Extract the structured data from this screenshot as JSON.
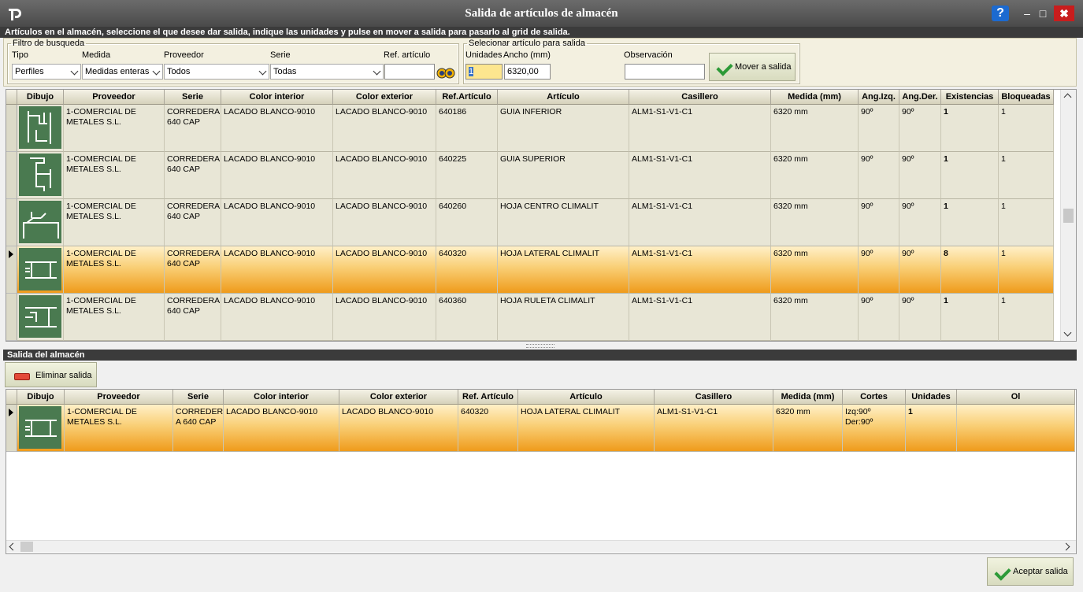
{
  "window": {
    "title": "Salida de artículos de almacén",
    "help": "?",
    "minimize": "–",
    "maximize": "□",
    "close": "✖"
  },
  "instructions": "Artículos en el almacén, seleccione el que desee dar salida, indique las unidades y pulse en mover a salida para pasarlo al grid de salida.",
  "filter": {
    "legend": "Filtro de busqueda",
    "tipo_label": "Tipo",
    "tipo_value": "Perfiles",
    "medida_label": "Medida",
    "medida_value": "Medidas enteras",
    "proveedor_label": "Proveedor",
    "proveedor_value": "Todos",
    "serie_label": "Serie",
    "serie_value": "Todas",
    "ref_label": "Ref. artículo",
    "ref_value": ""
  },
  "select": {
    "legend": "Selecionar artículo para salida",
    "unidades_label": "Unidades",
    "unidades_value": "1",
    "ancho_label": "Ancho (mm)",
    "ancho_value": "6320,00",
    "observacion_label": "Observación",
    "observacion_value": "",
    "move_button": "Mover a salida"
  },
  "stock_grid": {
    "columns": [
      "Dibujo",
      "Proveedor",
      "Serie",
      "Color interior",
      "Color exterior",
      "Ref.Artículo",
      "Artículo",
      "Casillero",
      "Medida (mm)",
      "Ang.Izq.",
      "Ang.Der.",
      "Existencias",
      "Bloqueadas"
    ],
    "rows": [
      {
        "proveedor": "1-COMERCIAL DE METALES S.L.",
        "serie": "CORREDERA 640 CAP",
        "color_int": "LACADO BLANCO-9010",
        "color_ext": "LACADO BLANCO-9010",
        "ref": "640186",
        "articulo": "GUIA INFERIOR",
        "casillero": "ALM1-S1-V1-C1",
        "medida": "6320 mm",
        "ang_izq": "90º",
        "ang_der": "90º",
        "existencias": "1",
        "bloqueadas": "1"
      },
      {
        "proveedor": "1-COMERCIAL DE METALES S.L.",
        "serie": "CORREDERA 640 CAP",
        "color_int": "LACADO BLANCO-9010",
        "color_ext": "LACADO BLANCO-9010",
        "ref": "640225",
        "articulo": "GUIA SUPERIOR",
        "casillero": "ALM1-S1-V1-C1",
        "medida": "6320 mm",
        "ang_izq": "90º",
        "ang_der": "90º",
        "existencias": "1",
        "bloqueadas": "1"
      },
      {
        "proveedor": "1-COMERCIAL DE METALES S.L.",
        "serie": "CORREDERA 640 CAP",
        "color_int": "LACADO BLANCO-9010",
        "color_ext": "LACADO BLANCO-9010",
        "ref": "640260",
        "articulo": "HOJA CENTRO CLIMALIT",
        "casillero": "ALM1-S1-V1-C1",
        "medida": "6320 mm",
        "ang_izq": "90º",
        "ang_der": "90º",
        "existencias": "1",
        "bloqueadas": "1"
      },
      {
        "proveedor": "1-COMERCIAL DE METALES S.L.",
        "serie": "CORREDERA 640 CAP",
        "color_int": "LACADO BLANCO-9010",
        "color_ext": "LACADO BLANCO-9010",
        "ref": "640320",
        "articulo": "HOJA LATERAL CLIMALIT",
        "casillero": "ALM1-S1-V1-C1",
        "medida": "6320 mm",
        "ang_izq": "90º",
        "ang_der": "90º",
        "existencias": "8",
        "bloqueadas": "1"
      },
      {
        "proveedor": "1-COMERCIAL DE METALES S.L.",
        "serie": "CORREDERA 640 CAP",
        "color_int": "LACADO BLANCO-9010",
        "color_ext": "LACADO BLANCO-9010",
        "ref": "640360",
        "articulo": "HOJA RULETA CLIMALIT",
        "casillero": "ALM1-S1-V1-C1",
        "medida": "6320 mm",
        "ang_izq": "90º",
        "ang_der": "90º",
        "existencias": "1",
        "bloqueadas": "1"
      }
    ]
  },
  "exit_section": {
    "title": "Salida del almacén",
    "remove_button": "Eliminar salida",
    "columns": [
      "Dibujo",
      "Proveedor",
      "Serie",
      "Color interior",
      "Color exterior",
      "Ref. Artículo",
      "Artículo",
      "Casillero",
      "Medida (mm)",
      "Cortes",
      "Unidades",
      "Ol"
    ],
    "rows": [
      {
        "proveedor": "1-COMERCIAL DE METALES S.L.",
        "serie": "CORREDER A 640 CAP",
        "color_int": "LACADO BLANCO-9010",
        "color_ext": "LACADO BLANCO-9010",
        "ref": "640320",
        "articulo": "HOJA LATERAL CLIMALIT",
        "casillero": "ALM1-S1-V1-C1",
        "medida": "6320 mm",
        "cortes_izq": "Izq:90º",
        "cortes_der": "Der:90º",
        "unidades": "1"
      }
    ],
    "accept_button": "Aceptar salida"
  }
}
